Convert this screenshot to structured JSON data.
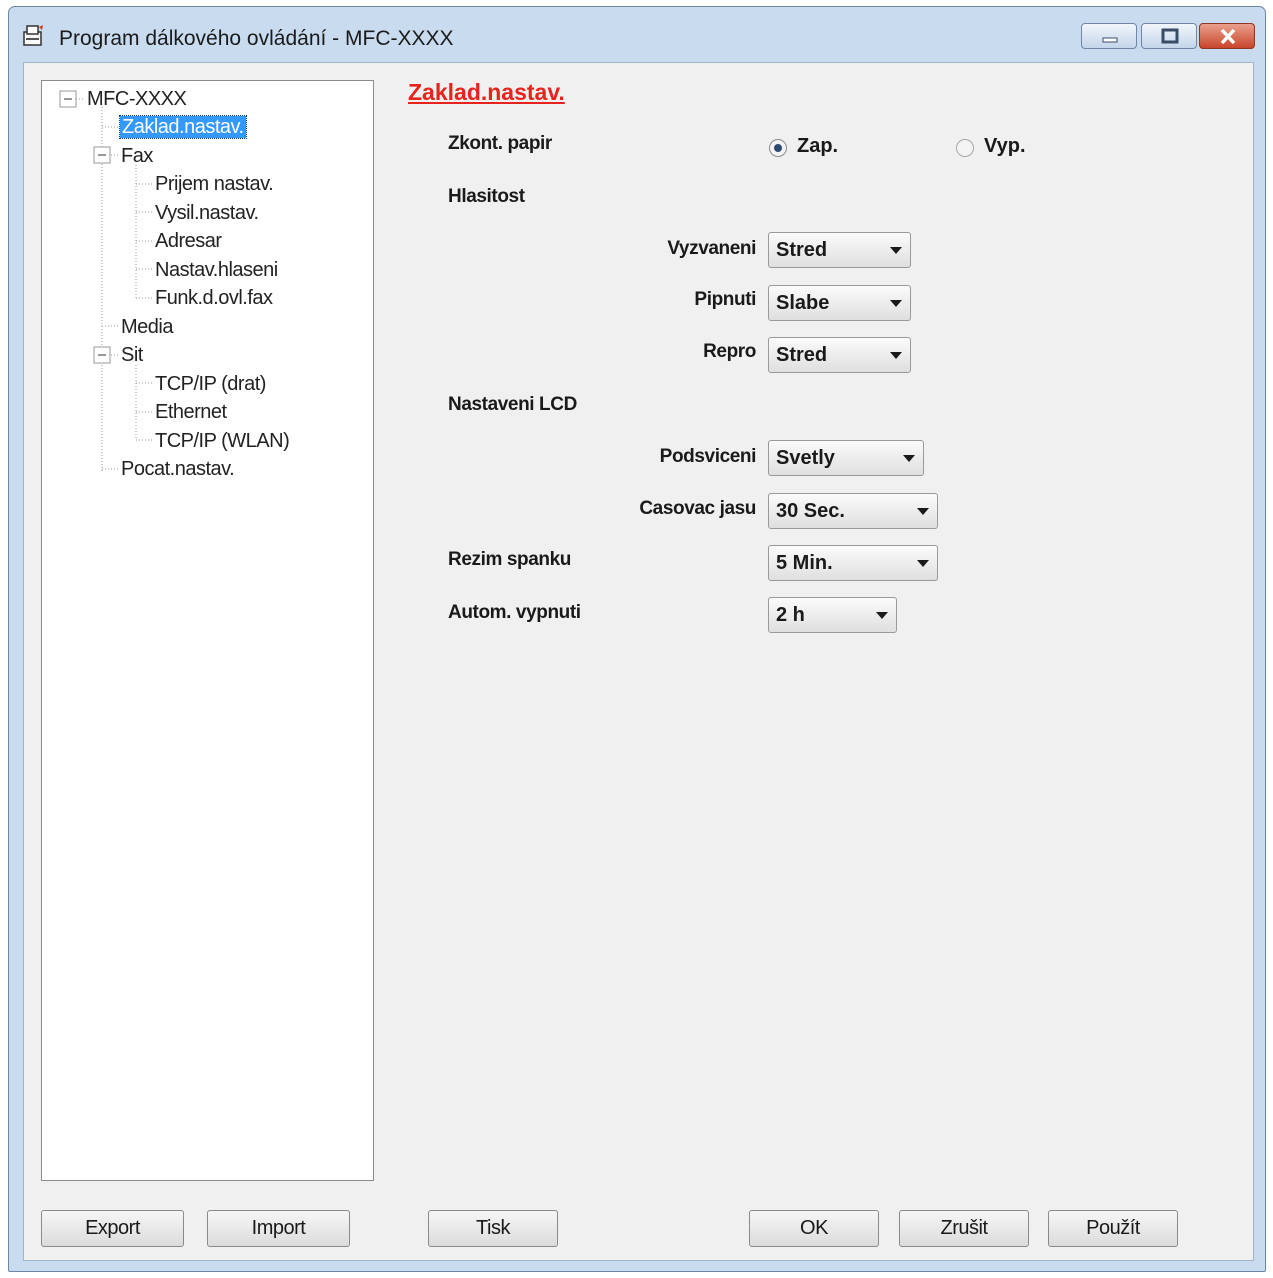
{
  "window": {
    "title": "Program dálkového ovládání - MFC-XXXX"
  },
  "tree": {
    "root": "MFC-XXXX",
    "items": [
      "Zaklad.nastav.",
      "Fax",
      "Prijem nastav.",
      "Vysil.nastav.",
      "Adresar",
      "Nastav.hlaseni",
      "Funk.d.ovl.fax",
      "Media",
      "Sit",
      "TCP/IP (drat)",
      "Ethernet",
      "TCP/IP (WLAN)",
      "Pocat.nastav."
    ],
    "selected": "Zaklad.nastav."
  },
  "panel": {
    "heading": "Zaklad.nastav.",
    "paper_check": {
      "label": "Zkont. papir",
      "on": "Zap.",
      "off": "Vyp.",
      "selected": "Zap."
    },
    "volume": {
      "label": "Hlasitost",
      "ring_label": "Vyzvaneni",
      "ring_value": "Stred",
      "beep_label": "Pipnuti",
      "beep_value": "Slabe",
      "speaker_label": "Repro",
      "speaker_value": "Stred"
    },
    "lcd": {
      "label": "Nastaveni LCD",
      "backlight_label": "Podsviceni",
      "backlight_value": "Svetly",
      "timer_label": "Casovac jasu",
      "timer_value": "30 Sec."
    },
    "sleep": {
      "label": "Rezim spanku",
      "value": "5 Min."
    },
    "auto_off": {
      "label": "Autom. vypnuti",
      "value": "2 h"
    }
  },
  "buttons": {
    "export": "Export",
    "import": "Import",
    "print": "Tisk",
    "ok": "OK",
    "cancel": "Zrušit",
    "apply": "Použít"
  },
  "colors": {
    "heading": "#e8231d",
    "selection": "#3399ff"
  },
  "icons": [
    "remote-setup-app-icon",
    "minimize-icon",
    "maximize-icon",
    "close-icon",
    "tree-collapse-icon",
    "radio-icon",
    "chevron-down-icon"
  ]
}
